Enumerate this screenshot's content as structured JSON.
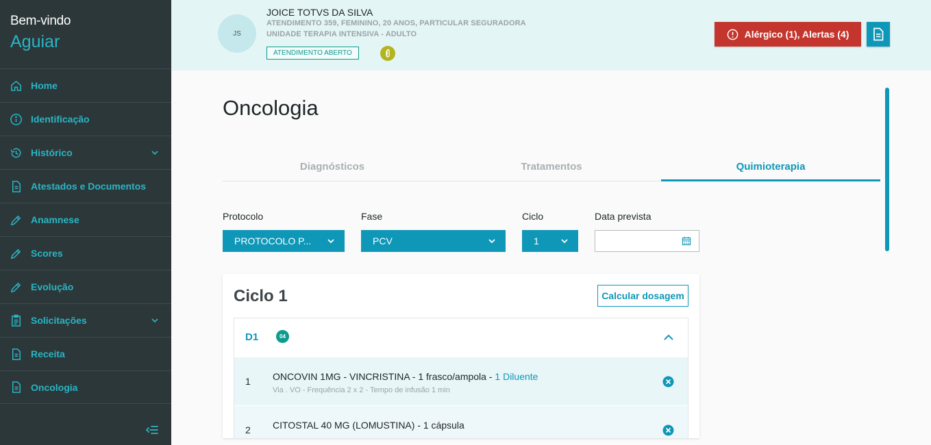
{
  "sidebar": {
    "welcome": "Bem-vindo",
    "username": "Aguiar",
    "items": [
      {
        "label": "Home",
        "icon": "home-icon"
      },
      {
        "label": "Identificação",
        "icon": "info-icon"
      },
      {
        "label": "Histórico",
        "icon": "history-icon",
        "expandable": true
      },
      {
        "label": "Atestados e Documentos",
        "icon": "document-icon"
      },
      {
        "label": "Anamnese",
        "icon": "pencil-icon"
      },
      {
        "label": "Scores",
        "icon": "pencil-icon"
      },
      {
        "label": "Evolução",
        "icon": "pencil-icon"
      },
      {
        "label": "Solicitações",
        "icon": "clipboard-icon",
        "expandable": true
      },
      {
        "label": "Receita",
        "icon": "document-icon"
      },
      {
        "label": "Oncologia",
        "icon": "document-icon"
      }
    ]
  },
  "patient": {
    "initials": "JS",
    "name": "JOICE TOTVS DA SILVA",
    "info_line1": "ATENDIMENTO 359, FEMININO, 20 ANOS, PARTICULAR SEGURADORA",
    "info_line2": "UNIDADE TERAPIA INTENSIVA - ADULTO",
    "status": "ATENDIMENTO ABERTO"
  },
  "alerts": {
    "label": "Alérgico (1),  Alertas (4)",
    "color": "#c4352d"
  },
  "page": {
    "title": "Oncologia",
    "tabs": [
      {
        "label": "Diagnósticos",
        "active": false
      },
      {
        "label": "Tratamentos",
        "active": false
      },
      {
        "label": "Quimioterapia",
        "active": true
      }
    ]
  },
  "form": {
    "protocolo_label": "Protocolo",
    "protocolo_value": "PROTOCOLO P...",
    "fase_label": "Fase",
    "fase_value": "PCV",
    "ciclo_label": "Ciclo",
    "ciclo_value": "1",
    "data_label": "Data prevista",
    "data_value": ""
  },
  "cycle": {
    "title": "Ciclo 1",
    "calc_button": "Calcular dosagem",
    "day": {
      "label": "D1",
      "count": "04",
      "drugs": [
        {
          "num": "1",
          "name": "ONCOVIN 1MG - VINCRISTINA - 1 frasco/ampola - ",
          "diluent": "1 Diluente",
          "details": "Via . VO - Frequência 2 x 2 - Tempo de infusão 1 min"
        },
        {
          "num": "2",
          "name": "CITOSTAL 40 MG (LOMUSTINA) - 1 cápsula",
          "diluent": "",
          "details": ""
        }
      ]
    }
  },
  "colors": {
    "accent": "#0f97b8",
    "sidebar_bg": "#2c3739",
    "header_bg": "#e4f5f6",
    "status_green": "#0c9b8e"
  }
}
